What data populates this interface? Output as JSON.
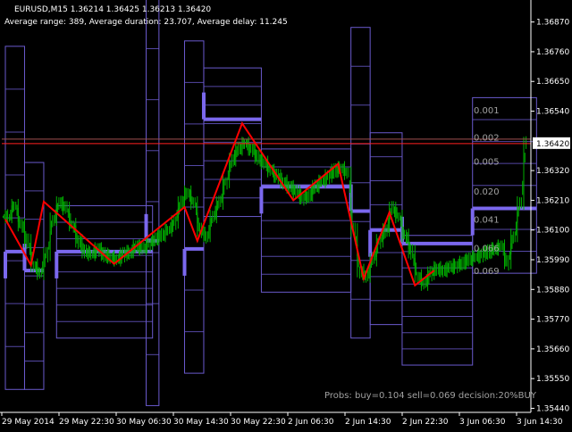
{
  "header": {
    "symbol_line": "EURUSD,M15  1.36214 1.36425 1.36213 1.36420",
    "stats_line": "Average range: 389, Average duration: 23.707, Average delay: 11.245"
  },
  "footer": {
    "probs_text": "Probs: buy=0.104 sell=0.069 decision:20%BUY"
  },
  "colors": {
    "background": "#000000",
    "candles": "#00b000",
    "levels": "#7b68ee",
    "levels_thin": "#6a5acd",
    "zigzag": "#ff0000",
    "price_line": "#ff2020",
    "axis_text": "#ffffff",
    "prob_text": "#a0a0a0",
    "price_tag_bg": "#ffffff",
    "price_tag_text": "#000000"
  },
  "chart_data": {
    "type": "line",
    "title": "EURUSD,M15",
    "ylim": [
      1.35425,
      1.36925
    ],
    "y_ticks": [
      "1.36870",
      "1.36760",
      "1.36650",
      "1.36540",
      "1.36420",
      "1.36320",
      "1.36210",
      "1.36100",
      "1.35990",
      "1.35880",
      "1.35770",
      "1.35660",
      "1.35550",
      "1.35440"
    ],
    "current_price_label": "1.36420",
    "x_ticks": [
      "29 May 2014",
      "29 May 22:30",
      "30 May 06:30",
      "30 May 14:30",
      "30 May 22:30",
      "2 Jun 06:30",
      "2 Jun 14:30",
      "2 Jun 22:30",
      "3 Jun 06:30",
      "3 Jun 14:30"
    ],
    "prob_labels": [
      {
        "text": "0.001",
        "price": 1.36545
      },
      {
        "text": "0.002",
        "price": 1.36445
      },
      {
        "text": "0.005",
        "price": 1.36355
      },
      {
        "text": "0.020",
        "price": 1.36245
      },
      {
        "text": "0.041",
        "price": 1.3614
      },
      {
        "text": "0.066",
        "price": 1.36035
      },
      {
        "text": "0.069",
        "price": 1.3595
      }
    ],
    "price_close": [
      1.3615,
      1.3619,
      1.3612,
      1.3606,
      1.3597,
      1.3594,
      1.3601,
      1.3614,
      1.362,
      1.3618,
      1.3612,
      1.3606,
      1.3602,
      1.3601,
      1.3603,
      1.3601,
      1.36,
      1.3599,
      1.3601,
      1.3602,
      1.3604,
      1.3603,
      1.3605,
      1.3607,
      1.3608,
      1.361,
      1.3613,
      1.362,
      1.3624,
      1.362,
      1.361,
      1.3608,
      1.3615,
      1.362,
      1.3628,
      1.3636,
      1.364,
      1.3642,
      1.364,
      1.3637,
      1.3635,
      1.3632,
      1.363,
      1.3628,
      1.3626,
      1.3624,
      1.3622,
      1.3623,
      1.3626,
      1.3628,
      1.363,
      1.3632,
      1.3633,
      1.3631,
      1.361,
      1.3595,
      1.3593,
      1.3599,
      1.3606,
      1.361,
      1.3618,
      1.3615,
      1.3608,
      1.3602,
      1.3593,
      1.359,
      1.3594,
      1.3596,
      1.3595,
      1.3596,
      1.3597,
      1.3598,
      1.3599,
      1.36,
      1.3601,
      1.3602,
      1.3603,
      1.3604,
      1.3598,
      1.3608,
      1.362,
      1.3642
    ],
    "zigzag": [
      {
        "i": 0,
        "price": 1.3614
      },
      {
        "i": 4,
        "price": 1.3597
      },
      {
        "i": 6,
        "price": 1.36205
      },
      {
        "i": 17,
        "price": 1.35975
      },
      {
        "i": 28,
        "price": 1.36185
      },
      {
        "i": 30,
        "price": 1.3606
      },
      {
        "i": 37,
        "price": 1.36495
      },
      {
        "i": 45,
        "price": 1.3621
      },
      {
        "i": 52,
        "price": 1.36345
      },
      {
        "i": 56,
        "price": 1.3592
      },
      {
        "i": 60,
        "price": 1.36165
      },
      {
        "i": 64,
        "price": 1.35895
      },
      {
        "i": 67,
        "price": 1.3595
      }
    ],
    "level_boxes": [
      {
        "i0": 0,
        "i1": 3,
        "top": 1.3678,
        "bottom": 1.3551,
        "mid": 1.3602
      },
      {
        "i0": 3,
        "i1": 6,
        "top": 1.3635,
        "bottom": 1.3551,
        "mid": 1.3595
      },
      {
        "i0": 8,
        "i1": 23,
        "top": 1.3619,
        "bottom": 1.357,
        "mid": 1.3602
      },
      {
        "i0": 22,
        "i1": 24,
        "top": 1.3696,
        "bottom": 1.3545,
        "mid": 1.3606
      },
      {
        "i0": 28,
        "i1": 31,
        "top": 1.368,
        "bottom": 1.3557,
        "mid": 1.3603
      },
      {
        "i0": 31,
        "i1": 40,
        "top": 1.367,
        "bottom": 1.3615,
        "mid": 1.3651
      },
      {
        "i0": 40,
        "i1": 54,
        "top": 1.364,
        "bottom": 1.3587,
        "mid": 1.3626
      },
      {
        "i0": 54,
        "i1": 57,
        "top": 1.3685,
        "bottom": 1.357,
        "mid": 1.3617
      },
      {
        "i0": 57,
        "i1": 62,
        "top": 1.3646,
        "bottom": 1.3575,
        "mid": 1.361
      },
      {
        "i0": 62,
        "i1": 73,
        "top": 1.3608,
        "bottom": 1.356,
        "mid": 1.3605
      },
      {
        "i0": 73,
        "i1": 83,
        "top": 1.3659,
        "bottom": 1.3594,
        "mid": 1.3618
      }
    ]
  }
}
